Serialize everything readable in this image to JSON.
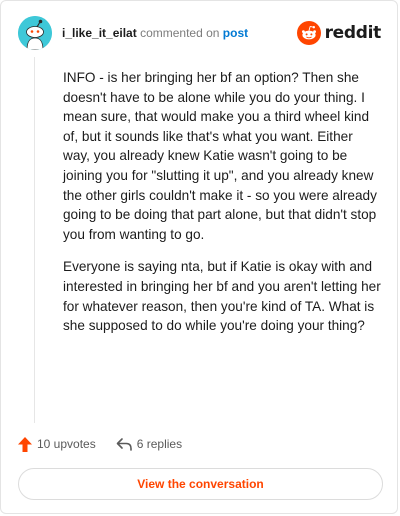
{
  "header": {
    "username": "i_like_it_eilat",
    "action_text": "commented on",
    "post_link": "post",
    "logo_text": "reddit",
    "avatar_icon": "snoo-avatar-icon",
    "logo_icon": "reddit-alien-icon"
  },
  "comment": {
    "paragraphs": [
      "INFO - is her bringing her bf an option? Then she doesn't have to be alone while you do your thing. I mean sure, that would make you a third wheel kind of, but it sounds like that's what you want. Either way, you already knew Katie wasn't going to be joining you for \"slutting it up\", and you already knew the other girls couldn't make it - so you were already going to be doing that part alone, but that didn't stop you from wanting to go.",
      "Everyone is saying nta, but if Katie is okay with and interested in bringing her bf and you aren't letting her for whatever reason, then you're kind of TA. What is she supposed to do while you're doing your thing?"
    ]
  },
  "footer": {
    "upvotes_label": "10 upvotes",
    "replies_label": "6 replies",
    "upvote_icon": "upvote-arrow-icon",
    "reply_icon": "reply-arrow-icon"
  },
  "cta": {
    "label": "View the conversation"
  },
  "colors": {
    "accent": "#ff4500",
    "link": "#0079d3",
    "avatar_bg": "#3ec8d8"
  }
}
